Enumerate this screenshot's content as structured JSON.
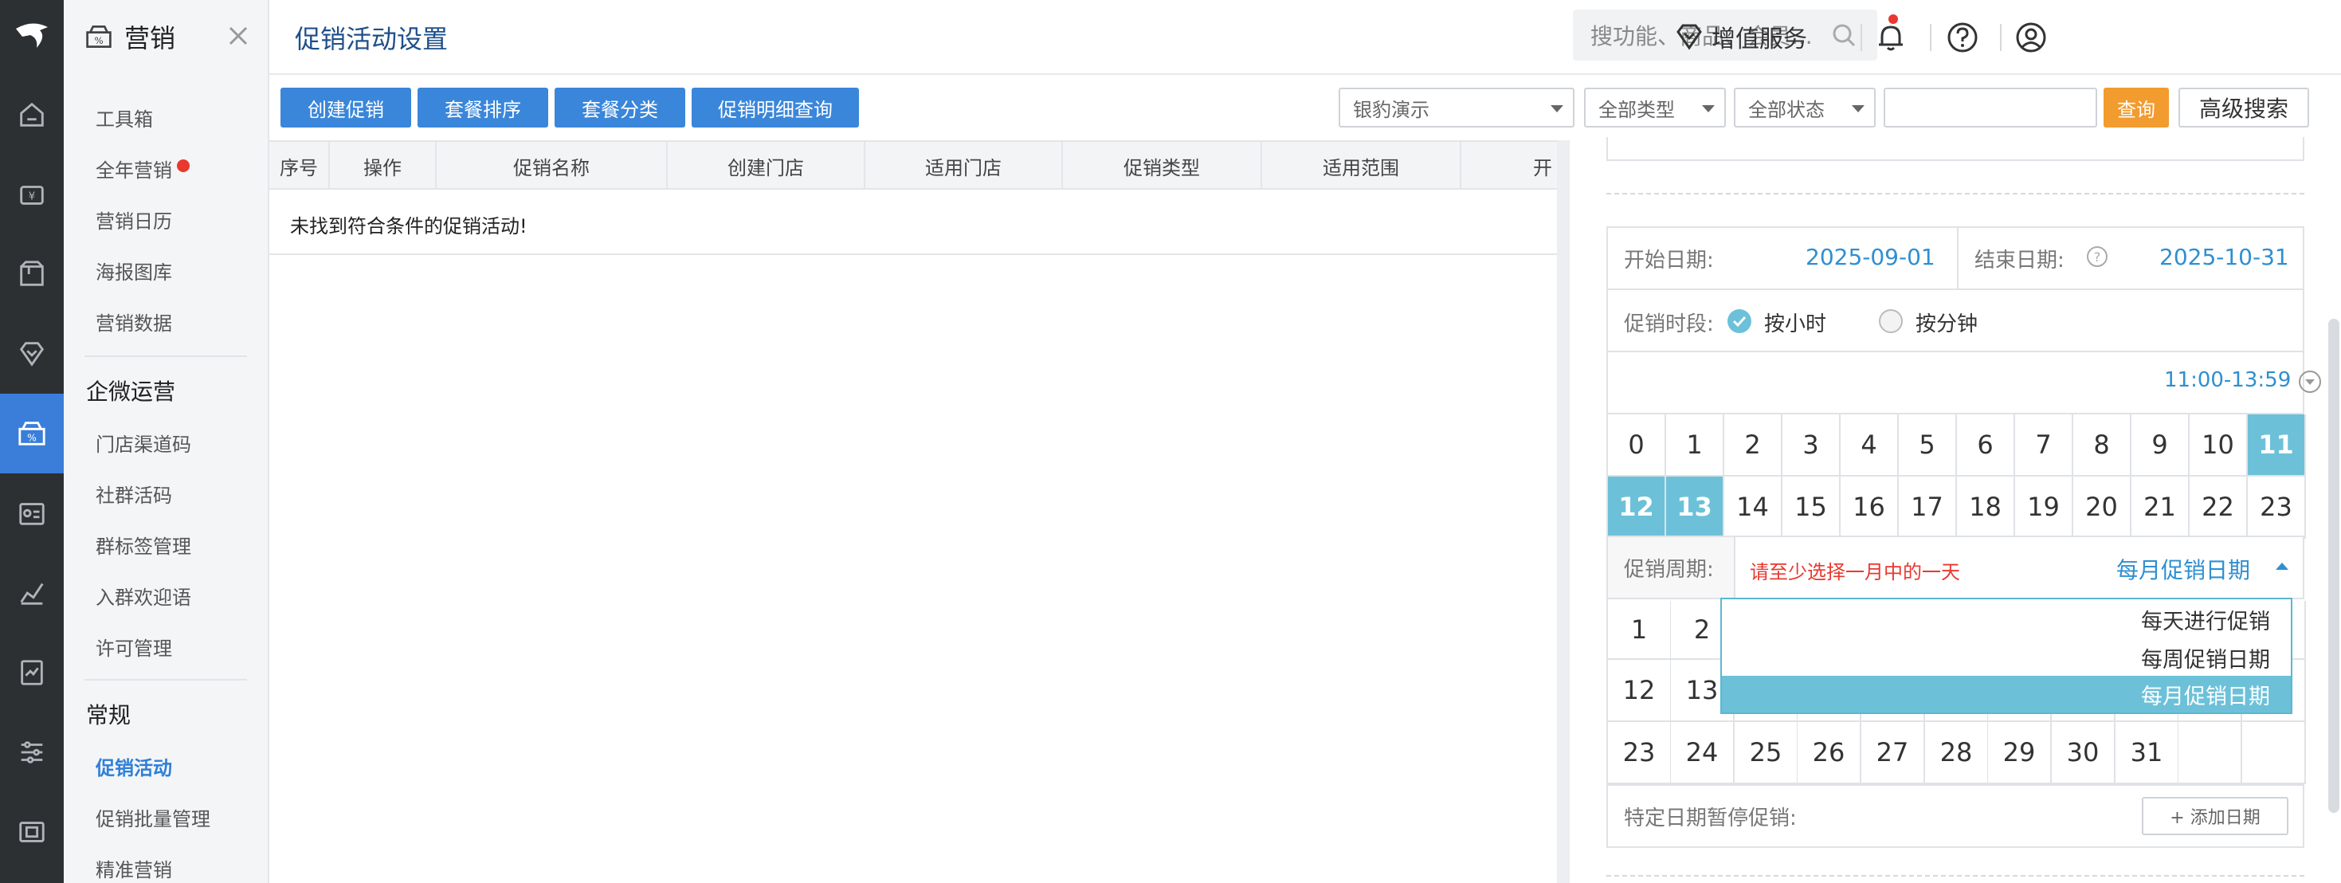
{
  "module": {
    "title": "营销"
  },
  "sidebar": {
    "items": [
      {
        "label": "工具箱"
      },
      {
        "label": "全年营销",
        "badge": "red-dot"
      },
      {
        "label": "营销日历"
      },
      {
        "label": "海报图库"
      },
      {
        "label": "营销数据"
      }
    ],
    "groups": [
      {
        "title": "企微运营",
        "items": [
          {
            "label": "门店渠道码"
          },
          {
            "label": "社群活码"
          },
          {
            "label": "群标签管理"
          },
          {
            "label": "入群欢迎语"
          },
          {
            "label": "许可管理"
          }
        ]
      },
      {
        "title": "常规",
        "items": [
          {
            "label": "促销活动",
            "active": true
          },
          {
            "label": "促销批量管理"
          },
          {
            "label": "精准营销"
          }
        ]
      }
    ]
  },
  "header": {
    "page_title": "促销活动设置",
    "search_placeholder": "搜功能、商品、会员...",
    "value_service": "增值服务"
  },
  "toolbar": {
    "buttons": [
      "创建促销",
      "套餐排序",
      "套餐分类",
      "促销明细查询"
    ],
    "store_select": "银豹演示",
    "type_select": "全部类型",
    "status_select": "全部状态",
    "query": "查询",
    "advanced": "高级搜索"
  },
  "table": {
    "columns": [
      "序号",
      "操作",
      "促销名称",
      "创建门店",
      "适用门店",
      "促销类型",
      "适用范围",
      "开"
    ],
    "empty_text": "未找到符合条件的促销活动!"
  },
  "panel": {
    "start_label": "开始日期:",
    "start_value": "2025-09-01",
    "end_label": "结束日期:",
    "end_value": "2025-10-31",
    "period_label": "促销时段:",
    "by_hour": "按小时",
    "by_minute": "按分钟",
    "time_range": "11:00-13:59",
    "hours": [
      "0",
      "1",
      "2",
      "3",
      "4",
      "5",
      "6",
      "7",
      "8",
      "9",
      "10",
      "11",
      "12",
      "13",
      "14",
      "15",
      "16",
      "17",
      "18",
      "19",
      "20",
      "21",
      "22",
      "23"
    ],
    "selected_hours": [
      "11",
      "12",
      "13"
    ],
    "cycle_label": "促销周期:",
    "cycle_warning": "请至少选择一月中的一天",
    "cycle_value": "每月促销日期",
    "cycle_options": [
      "每天进行促销",
      "每周促销日期",
      "每月促销日期"
    ],
    "days_row1": [
      "1",
      "2"
    ],
    "days_row2": [
      "12",
      "13"
    ],
    "days_row3": [
      "23",
      "24",
      "25",
      "26",
      "27",
      "28",
      "29",
      "30",
      "31"
    ],
    "pause_label": "特定日期暂停促销:",
    "add_date": "+ 添加日期"
  },
  "colors": {
    "accent": "#3a86da",
    "selected": "#6cc1d9",
    "orange": "#f29b2f",
    "warning": "#e8382f"
  }
}
